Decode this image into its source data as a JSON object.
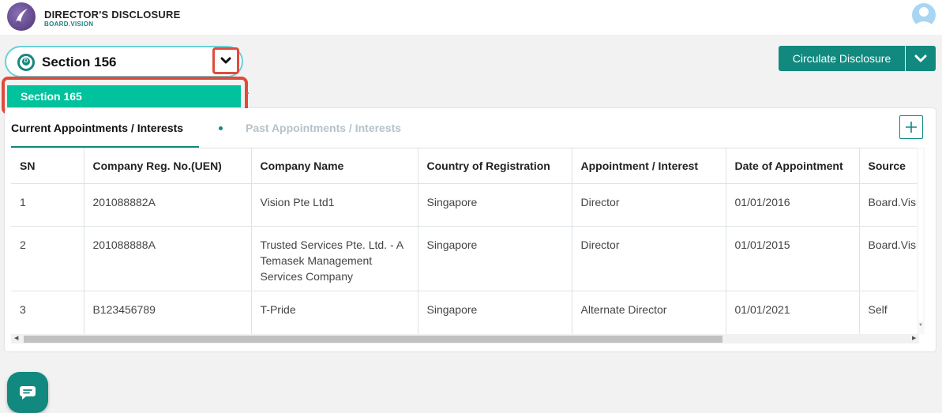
{
  "header": {
    "title": "DIRECTOR'S DISCLOSURE",
    "subtitle": "BOARD.VISION",
    "logo_icon": "board-vision-logo-icon",
    "avatar_icon": "user-avatar-icon"
  },
  "section_select": {
    "badge": "D",
    "selected": "Section 156",
    "toggle_icon": "chevron-down-icon",
    "options": [
      "Section 165"
    ]
  },
  "actions": {
    "circulate_label": "Circulate Disclosure",
    "caret_icon": "chevron-down-icon",
    "add_icon": "plus-icon"
  },
  "tabs": {
    "current": "Current Appointments / Interests",
    "past": "Past Appointments / Interests"
  },
  "table": {
    "columns": [
      "SN",
      "Company Reg. No.(UEN)",
      "Company Name",
      "Country of Registration",
      "Appointment / Interest",
      "Date of Appointment",
      "Source"
    ],
    "rows": [
      [
        "1",
        "201088882A",
        "Vision Pte Ltd1",
        "Singapore",
        "Director",
        "01/01/2016",
        "Board.Vision"
      ],
      [
        "2",
        "201088888A",
        "Trusted Services Pte. Ltd. - A Temasek Management Services Company",
        "Singapore",
        "Director",
        "01/01/2015",
        "Board.Vision"
      ],
      [
        "3",
        "B123456789",
        "T-Pride",
        "Singapore",
        "Alternate Director",
        "01/01/2021",
        "Self"
      ]
    ]
  },
  "colors": {
    "primary": "#11897f",
    "highlight": "#e04b3b",
    "option_bg": "#00c29c"
  },
  "chat": {
    "icon": "chat-bubble-icon"
  }
}
